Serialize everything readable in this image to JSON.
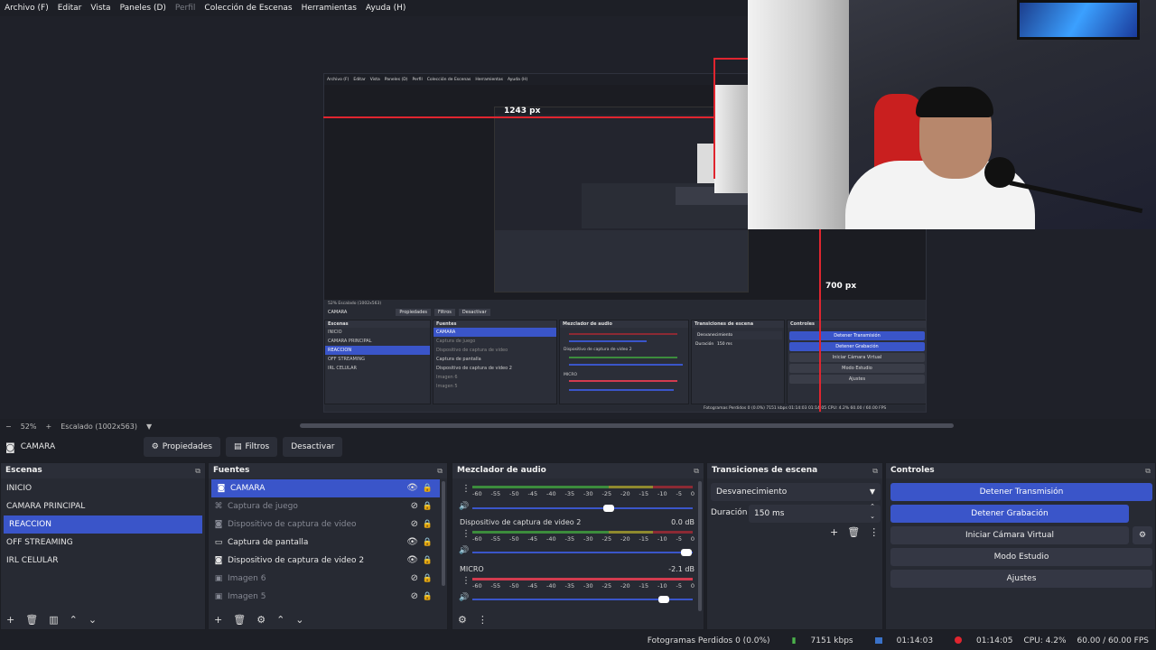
{
  "menu": [
    "Archivo (F)",
    "Editar",
    "Vista",
    "Paneles (D)",
    "Perfil",
    "Colección de Escenas",
    "Herramientas",
    "Ayuda (H)"
  ],
  "preview": {
    "dim_width_label": "1243 px",
    "dim_height_label": "700 px"
  },
  "zoom": {
    "minus": "−",
    "percent": "52%",
    "plus": "+",
    "scale_label": "Escalado (1002x563)",
    "dropdown": "▼"
  },
  "source_toolbar": {
    "current_source": "CAMARA",
    "properties_label": "Propiedades",
    "filters_label": "Filtros",
    "deactivate_label": "Desactivar"
  },
  "scenes": {
    "title": "Escenas",
    "items": [
      "INICIO",
      "CAMARA PRINCIPAL",
      "REACCION",
      "OFF STREAMING",
      "IRL CELULAR"
    ],
    "selected_index": 2
  },
  "sources": {
    "title": "Fuentes",
    "items": [
      {
        "label": "CAMARA",
        "icon": "camera-icon",
        "visible": true,
        "selected": true
      },
      {
        "label": "Captura de juego",
        "icon": "gamepad-icon",
        "visible": false,
        "selected": false
      },
      {
        "label": "Dispositivo de captura de video",
        "icon": "camera-icon",
        "visible": false,
        "selected": false
      },
      {
        "label": "Captura de pantalla",
        "icon": "monitor-icon",
        "visible": true,
        "selected": false
      },
      {
        "label": "Dispositivo de captura de video 2",
        "icon": "camera-icon",
        "visible": true,
        "selected": false
      },
      {
        "label": "Imagen 6",
        "icon": "image-icon",
        "visible": false,
        "selected": false
      },
      {
        "label": "Imagen 5",
        "icon": "image-icon",
        "visible": false,
        "selected": false
      }
    ]
  },
  "mixer": {
    "title": "Mezclador de audio",
    "ticks": [
      "-60",
      "-55",
      "-50",
      "-45",
      "-40",
      "-35",
      "-30",
      "-25",
      "-20",
      "-15",
      "-10",
      "-5",
      "0"
    ],
    "channels": [
      {
        "name": "",
        "db": "",
        "volume": 0.62
      },
      {
        "name": "Dispositivo de captura de video 2",
        "db": "0.0 dB",
        "volume": 0.97
      },
      {
        "name": "MICRO",
        "db": "-2.1 dB",
        "volume": 0.87
      }
    ]
  },
  "transitions": {
    "title": "Transiciones de escena",
    "selected": "Desvanecimiento",
    "duration_label": "Duración",
    "duration_value": "150 ms"
  },
  "controls": {
    "title": "Controles",
    "stop_stream": "Detener Transmisión",
    "stop_record": "Detener Grabación",
    "virtual_cam": "Iniciar Cámara Virtual",
    "studio_mode": "Modo Estudio",
    "settings": "Ajustes"
  },
  "status": {
    "dropped_frames": "Fotogramas Perdidos 0 (0.0%)",
    "bitrate": "7151 kbps",
    "stream_time": "01:14:03",
    "record_time": "01:14:05",
    "cpu": "CPU: 4.2%",
    "fps": "60.00 / 60.00 FPS"
  },
  "nested": {
    "menu": [
      "Archivo (F)",
      "Editar",
      "Vista",
      "Paneles (D)",
      "Perfil",
      "Colección de Escenas",
      "Herramientas",
      "Ayuda (H)"
    ],
    "zoom_text": "52%    Escalado (1002x563)",
    "source_name": "CAMARA",
    "properties": "Propiedades",
    "filters": "Filtros",
    "deactivate": "Desactivar",
    "scenes_title": "Escenas",
    "sources_title": "Fuentes",
    "mixer_title": "Mezclador de audio",
    "transitions_title": "Transiciones de escena",
    "controls_title": "Controles",
    "scenes": [
      "INICIO",
      "CAMARA PRINCIPAL",
      "REACCION",
      "OFF STREAMING",
      "IRL CELULAR"
    ],
    "sources": [
      "CAMARA",
      "Captura de juego",
      "Dispositivo de captura de video",
      "Captura de pantalla",
      "Dispositivo de captura de video 2",
      "Imagen 6",
      "Imagen 5"
    ],
    "mixer_ch2": "Dispositivo de captura de video 2",
    "mixer_ch3": "MICRO",
    "transition": "Desvanecimiento",
    "duration_label": "Duración",
    "duration": "150 ms",
    "btn_stream": "Detener Transmisión",
    "btn_record": "Detener Grabación",
    "btn_vcam": "Iniciar Cámara Virtual",
    "btn_studio": "Modo Estudio",
    "btn_settings": "Ajustes",
    "status": "Fotogramas Perdidos 0 (0.0%)   7151 kbps   01:14:03   01:14:05   CPU: 4.2%   60.00 / 60.00 FPS"
  }
}
